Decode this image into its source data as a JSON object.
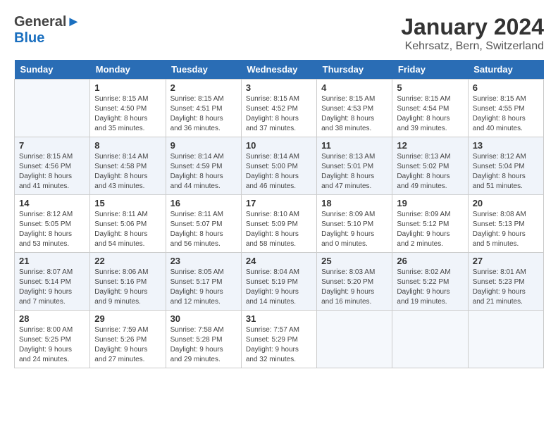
{
  "header": {
    "logo_general": "General",
    "logo_blue": "Blue",
    "month_title": "January 2024",
    "location": "Kehrsatz, Bern, Switzerland"
  },
  "days_of_week": [
    "Sunday",
    "Monday",
    "Tuesday",
    "Wednesday",
    "Thursday",
    "Friday",
    "Saturday"
  ],
  "weeks": [
    [
      {
        "day": "",
        "sunrise": "",
        "sunset": "",
        "daylight": ""
      },
      {
        "day": "1",
        "sunrise": "Sunrise: 8:15 AM",
        "sunset": "Sunset: 4:50 PM",
        "daylight": "Daylight: 8 hours and 35 minutes."
      },
      {
        "day": "2",
        "sunrise": "Sunrise: 8:15 AM",
        "sunset": "Sunset: 4:51 PM",
        "daylight": "Daylight: 8 hours and 36 minutes."
      },
      {
        "day": "3",
        "sunrise": "Sunrise: 8:15 AM",
        "sunset": "Sunset: 4:52 PM",
        "daylight": "Daylight: 8 hours and 37 minutes."
      },
      {
        "day": "4",
        "sunrise": "Sunrise: 8:15 AM",
        "sunset": "Sunset: 4:53 PM",
        "daylight": "Daylight: 8 hours and 38 minutes."
      },
      {
        "day": "5",
        "sunrise": "Sunrise: 8:15 AM",
        "sunset": "Sunset: 4:54 PM",
        "daylight": "Daylight: 8 hours and 39 minutes."
      },
      {
        "day": "6",
        "sunrise": "Sunrise: 8:15 AM",
        "sunset": "Sunset: 4:55 PM",
        "daylight": "Daylight: 8 hours and 40 minutes."
      }
    ],
    [
      {
        "day": "7",
        "sunrise": "Sunrise: 8:15 AM",
        "sunset": "Sunset: 4:56 PM",
        "daylight": "Daylight: 8 hours and 41 minutes."
      },
      {
        "day": "8",
        "sunrise": "Sunrise: 8:14 AM",
        "sunset": "Sunset: 4:58 PM",
        "daylight": "Daylight: 8 hours and 43 minutes."
      },
      {
        "day": "9",
        "sunrise": "Sunrise: 8:14 AM",
        "sunset": "Sunset: 4:59 PM",
        "daylight": "Daylight: 8 hours and 44 minutes."
      },
      {
        "day": "10",
        "sunrise": "Sunrise: 8:14 AM",
        "sunset": "Sunset: 5:00 PM",
        "daylight": "Daylight: 8 hours and 46 minutes."
      },
      {
        "day": "11",
        "sunrise": "Sunrise: 8:13 AM",
        "sunset": "Sunset: 5:01 PM",
        "daylight": "Daylight: 8 hours and 47 minutes."
      },
      {
        "day": "12",
        "sunrise": "Sunrise: 8:13 AM",
        "sunset": "Sunset: 5:02 PM",
        "daylight": "Daylight: 8 hours and 49 minutes."
      },
      {
        "day": "13",
        "sunrise": "Sunrise: 8:12 AM",
        "sunset": "Sunset: 5:04 PM",
        "daylight": "Daylight: 8 hours and 51 minutes."
      }
    ],
    [
      {
        "day": "14",
        "sunrise": "Sunrise: 8:12 AM",
        "sunset": "Sunset: 5:05 PM",
        "daylight": "Daylight: 8 hours and 53 minutes."
      },
      {
        "day": "15",
        "sunrise": "Sunrise: 8:11 AM",
        "sunset": "Sunset: 5:06 PM",
        "daylight": "Daylight: 8 hours and 54 minutes."
      },
      {
        "day": "16",
        "sunrise": "Sunrise: 8:11 AM",
        "sunset": "Sunset: 5:07 PM",
        "daylight": "Daylight: 8 hours and 56 minutes."
      },
      {
        "day": "17",
        "sunrise": "Sunrise: 8:10 AM",
        "sunset": "Sunset: 5:09 PM",
        "daylight": "Daylight: 8 hours and 58 minutes."
      },
      {
        "day": "18",
        "sunrise": "Sunrise: 8:09 AM",
        "sunset": "Sunset: 5:10 PM",
        "daylight": "Daylight: 9 hours and 0 minutes."
      },
      {
        "day": "19",
        "sunrise": "Sunrise: 8:09 AM",
        "sunset": "Sunset: 5:12 PM",
        "daylight": "Daylight: 9 hours and 2 minutes."
      },
      {
        "day": "20",
        "sunrise": "Sunrise: 8:08 AM",
        "sunset": "Sunset: 5:13 PM",
        "daylight": "Daylight: 9 hours and 5 minutes."
      }
    ],
    [
      {
        "day": "21",
        "sunrise": "Sunrise: 8:07 AM",
        "sunset": "Sunset: 5:14 PM",
        "daylight": "Daylight: 9 hours and 7 minutes."
      },
      {
        "day": "22",
        "sunrise": "Sunrise: 8:06 AM",
        "sunset": "Sunset: 5:16 PM",
        "daylight": "Daylight: 9 hours and 9 minutes."
      },
      {
        "day": "23",
        "sunrise": "Sunrise: 8:05 AM",
        "sunset": "Sunset: 5:17 PM",
        "daylight": "Daylight: 9 hours and 12 minutes."
      },
      {
        "day": "24",
        "sunrise": "Sunrise: 8:04 AM",
        "sunset": "Sunset: 5:19 PM",
        "daylight": "Daylight: 9 hours and 14 minutes."
      },
      {
        "day": "25",
        "sunrise": "Sunrise: 8:03 AM",
        "sunset": "Sunset: 5:20 PM",
        "daylight": "Daylight: 9 hours and 16 minutes."
      },
      {
        "day": "26",
        "sunrise": "Sunrise: 8:02 AM",
        "sunset": "Sunset: 5:22 PM",
        "daylight": "Daylight: 9 hours and 19 minutes."
      },
      {
        "day": "27",
        "sunrise": "Sunrise: 8:01 AM",
        "sunset": "Sunset: 5:23 PM",
        "daylight": "Daylight: 9 hours and 21 minutes."
      }
    ],
    [
      {
        "day": "28",
        "sunrise": "Sunrise: 8:00 AM",
        "sunset": "Sunset: 5:25 PM",
        "daylight": "Daylight: 9 hours and 24 minutes."
      },
      {
        "day": "29",
        "sunrise": "Sunrise: 7:59 AM",
        "sunset": "Sunset: 5:26 PM",
        "daylight": "Daylight: 9 hours and 27 minutes."
      },
      {
        "day": "30",
        "sunrise": "Sunrise: 7:58 AM",
        "sunset": "Sunset: 5:28 PM",
        "daylight": "Daylight: 9 hours and 29 minutes."
      },
      {
        "day": "31",
        "sunrise": "Sunrise: 7:57 AM",
        "sunset": "Sunset: 5:29 PM",
        "daylight": "Daylight: 9 hours and 32 minutes."
      },
      {
        "day": "",
        "sunrise": "",
        "sunset": "",
        "daylight": ""
      },
      {
        "day": "",
        "sunrise": "",
        "sunset": "",
        "daylight": ""
      },
      {
        "day": "",
        "sunrise": "",
        "sunset": "",
        "daylight": ""
      }
    ]
  ]
}
